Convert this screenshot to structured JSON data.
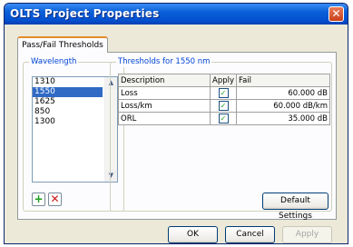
{
  "window": {
    "title": "OLTS Project Properties"
  },
  "tabs": [
    {
      "label": "Pass/Fail Thresholds"
    }
  ],
  "wavelength": {
    "group_label": "Wavelength",
    "items": [
      "1310",
      "1550",
      "1625",
      "850",
      "1300"
    ],
    "selected": "1550"
  },
  "thresholds": {
    "group_label": "Thresholds for 1550 nm",
    "columns": [
      "Description",
      "Apply",
      "Fail"
    ],
    "rows": [
      {
        "description": "Loss",
        "apply": true,
        "fail": "60.000 dB"
      },
      {
        "description": "Loss/km",
        "apply": true,
        "fail": "60.000 dB/km"
      },
      {
        "description": "ORL",
        "apply": true,
        "fail": "35.000 dB"
      }
    ],
    "default_settings_label": "Default Settings"
  },
  "buttons": {
    "ok": "OK",
    "cancel": "Cancel",
    "apply": "Apply"
  },
  "icons": {
    "close": "close-icon",
    "add": "plus-icon",
    "remove": "x-icon",
    "check": "checkmark-icon"
  },
  "colors": {
    "titlebar": "#0450d0",
    "selection": "#316ac5",
    "group_label": "#0046d5",
    "add_green": "#1a9e1a",
    "remove_red": "#d01818"
  }
}
